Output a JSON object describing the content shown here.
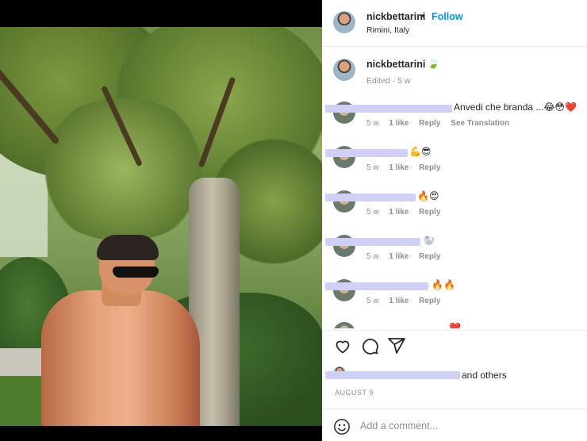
{
  "post": {
    "username": "nickbettarini",
    "follow_separator": "•",
    "follow_label": "Follow",
    "location": "Rimini, Italy"
  },
  "caption": {
    "username": "nickbettarini",
    "emoji": "🍃",
    "meta": "Edited · 5 w"
  },
  "comments": [
    {
      "text": "Anvedi che branda ...😂😳❤️",
      "time": "5 w",
      "likes": "1 like",
      "reply": "Reply",
      "translate": "See Translation"
    },
    {
      "text": "💪😎",
      "time": "5 w",
      "likes": "1 like",
      "reply": "Reply"
    },
    {
      "text": "🔥😍",
      "time": "5 w",
      "likes": "1 like",
      "reply": "Reply"
    },
    {
      "text": "🦭",
      "time": "5 w",
      "likes": "1 like",
      "reply": "Reply"
    },
    {
      "text": "🔥🔥",
      "time": "5 w",
      "likes": "1 like",
      "reply": "Reply"
    },
    {
      "text": "❤️"
    }
  ],
  "likes": {
    "text": "and others"
  },
  "date": "AUGUST 9",
  "add_comment": {
    "placeholder": "Add a comment..."
  },
  "colors": {
    "link": "#0095f6",
    "muted": "#8e8e8e",
    "redaction": "#cfd0f5"
  },
  "icons": {
    "like": "heart-icon",
    "comment": "comment-icon",
    "share": "share-icon",
    "emoji": "emoji-icon"
  }
}
